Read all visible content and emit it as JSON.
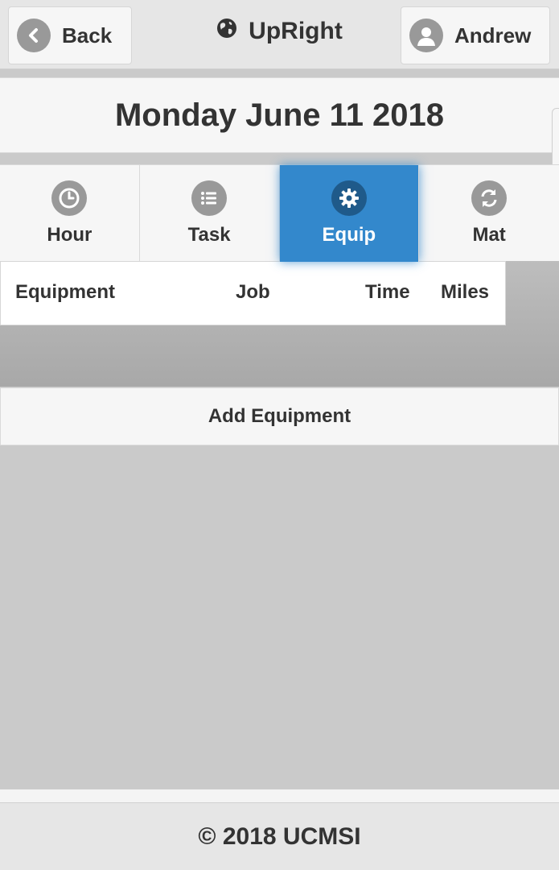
{
  "header": {
    "back_label": "Back",
    "app_title": "UpRight",
    "user_label": "Andrew"
  },
  "date_bar": {
    "date": "Monday June 11 2018"
  },
  "tabs": [
    {
      "label": "Hour",
      "icon": "clock-icon",
      "active": false
    },
    {
      "label": "Task",
      "icon": "list-icon",
      "active": false
    },
    {
      "label": "Equip",
      "icon": "gear-icon",
      "active": true
    },
    {
      "label": "Mat",
      "icon": "refresh-icon",
      "active": false
    }
  ],
  "table": {
    "columns": [
      "Equipment",
      "Job",
      "Time",
      "Miles"
    ],
    "rows": []
  },
  "add_button": {
    "label": "Add Equipment"
  },
  "footer": {
    "text": "© 2018 UCMSI"
  },
  "colors": {
    "accent": "#3388cc",
    "icon_gray": "#999999",
    "header_bg": "#e6e6e6"
  }
}
